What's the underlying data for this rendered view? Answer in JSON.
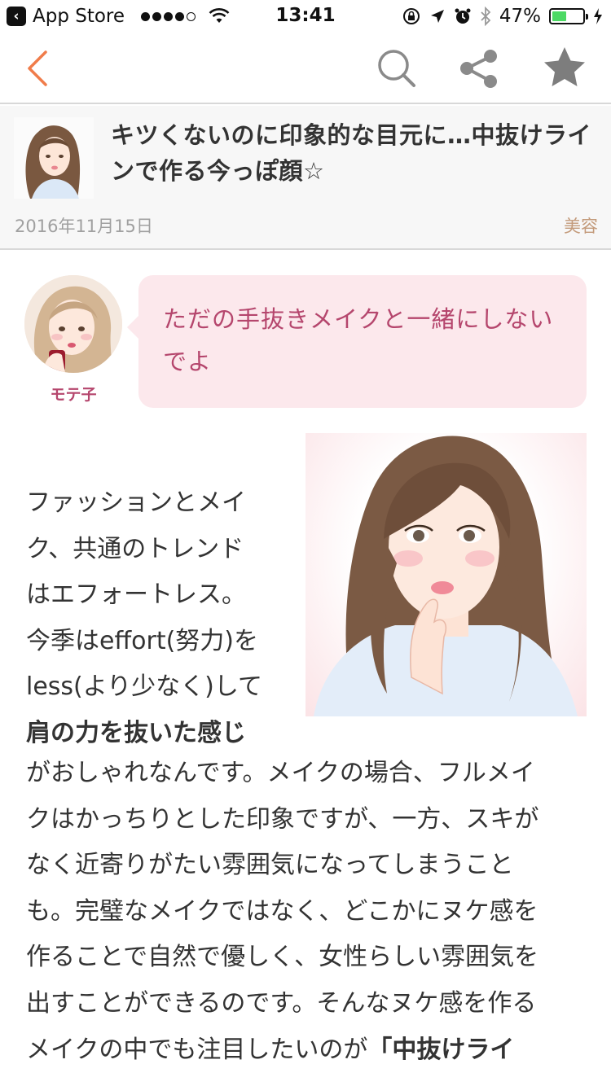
{
  "status_bar": {
    "back_label": "App Store",
    "time": "13:41",
    "battery_percent": "47%",
    "battery_level": 0.47,
    "signal_bars_filled": 4,
    "signal_bars_total": 5
  },
  "nav": {
    "back_icon": "chevron-left-icon",
    "search_icon": "search-icon",
    "share_icon": "share-icon",
    "favorite_icon": "star-icon",
    "accent_color": "#f07c4a"
  },
  "article": {
    "title": "キツくないのに印象的な目元に…中抜けラインで作る今っぽ顔☆",
    "date": "2016年11月15日",
    "category": "美容"
  },
  "speaker": {
    "name": "モテ子",
    "message": "ただの手抜きメイクと一緒にしないでよ"
  },
  "content": {
    "narrow_lines": [
      "ファッションとメイ",
      "ク、共通のトレンド",
      "はエフォートレス。",
      "今季はeffort(努力)を",
      "less(より少なく)して"
    ],
    "narrow_bold": "肩の力を抜いた感じ",
    "wide_lines": [
      "がおしゃれなんです。メイクの場合、フルメイ",
      "クはかっちりとした印象ですが、一方、スキが",
      "なく近寄りがたい雰囲気になってしまうこと",
      "も。完璧なメイクではなく、どこかにヌケ感を",
      "作ることで自然で優しく、女性らしい雰囲気を",
      "出すことができるのです。そんなヌケ感を作る"
    ],
    "last_line_text": "メイクの中でも注目したいのが",
    "last_line_bold": "「中抜けライ"
  },
  "colors": {
    "accent": "#f07c4a",
    "speech_bubble": "#fce8ec",
    "speech_text": "#b5466d",
    "category_text": "#c39a7a"
  }
}
